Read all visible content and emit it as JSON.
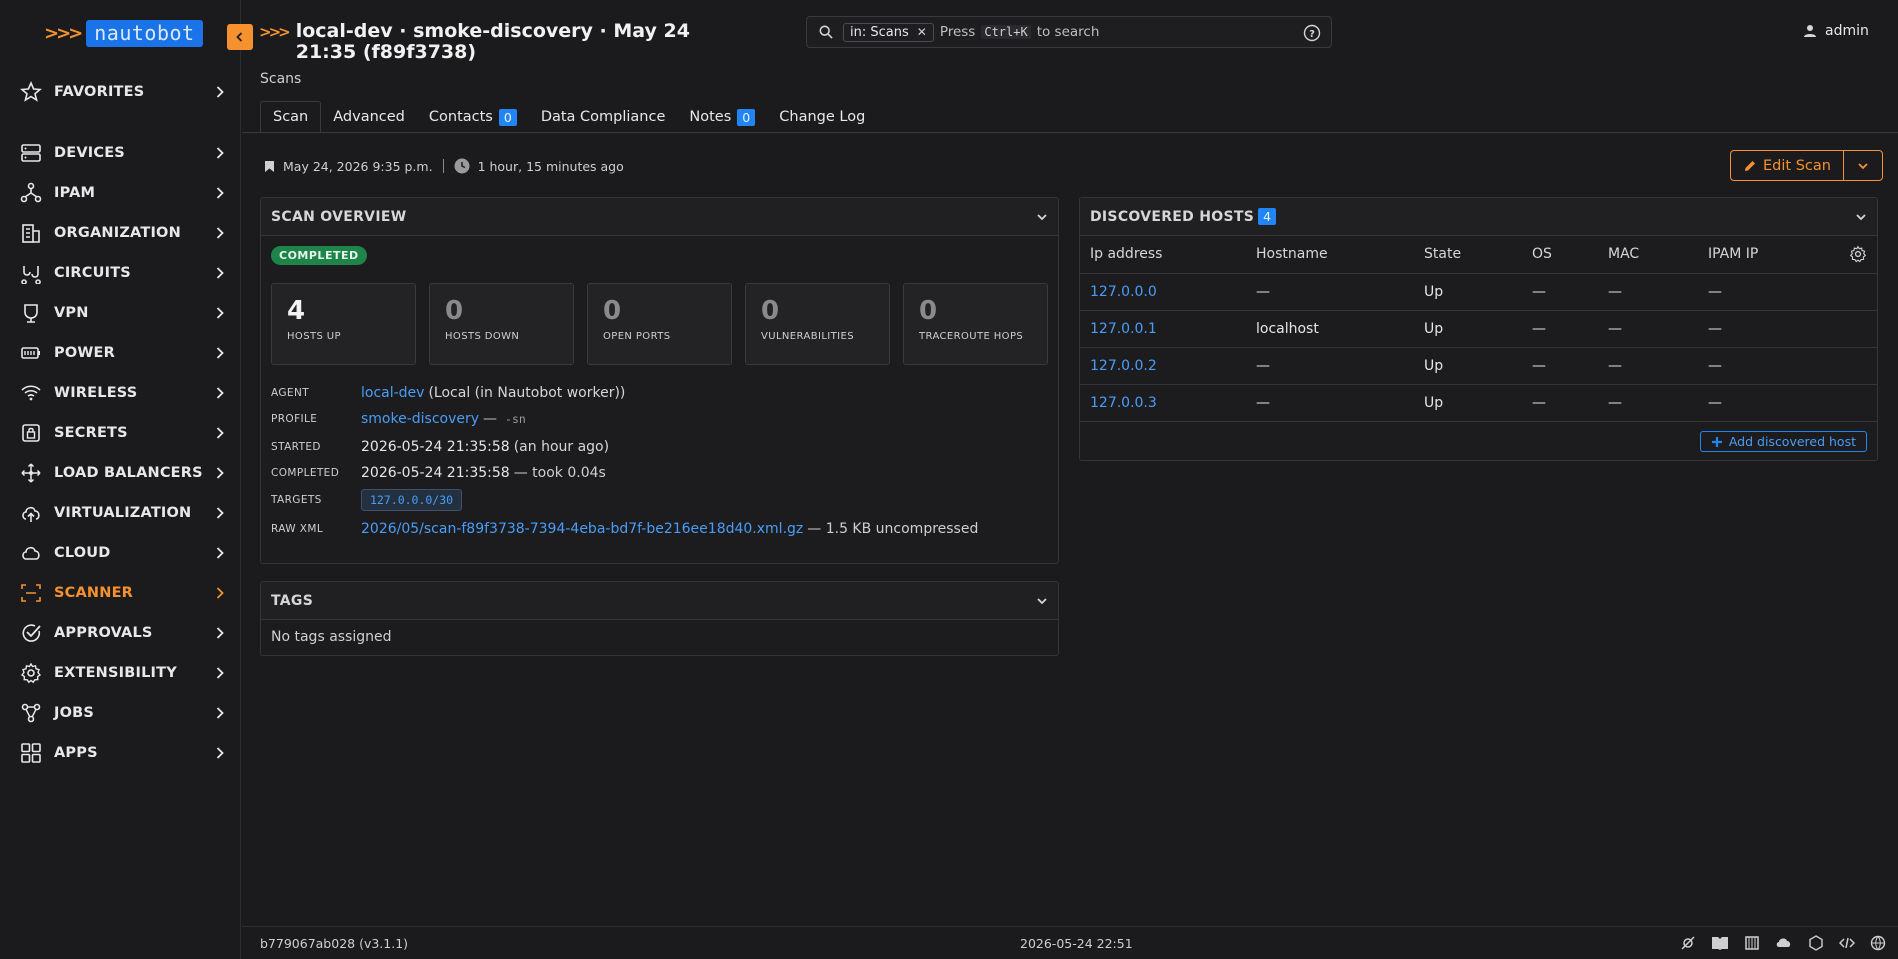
{
  "brand": {
    "chevrons": ">>>",
    "name": "nautobot",
    "accent": "#f5922f",
    "link": "#4a9df7"
  },
  "sidebar": {
    "items": [
      {
        "label": "FAVORITES",
        "icon": "star-icon"
      },
      {
        "label": "DEVICES",
        "icon": "server-icon"
      },
      {
        "label": "IPAM",
        "icon": "network-icon"
      },
      {
        "label": "ORGANIZATION",
        "icon": "building-icon"
      },
      {
        "label": "CIRCUITS",
        "icon": "circuit-icon"
      },
      {
        "label": "VPN",
        "icon": "shield-icon"
      },
      {
        "label": "POWER",
        "icon": "battery-icon"
      },
      {
        "label": "WIRELESS",
        "icon": "wifi-icon"
      },
      {
        "label": "SECRETS",
        "icon": "lock-icon"
      },
      {
        "label": "LOAD BALANCERS",
        "icon": "balancer-icon"
      },
      {
        "label": "VIRTUALIZATION",
        "icon": "cloud-upload-icon"
      },
      {
        "label": "CLOUD",
        "icon": "cloud-icon"
      },
      {
        "label": "SCANNER",
        "icon": "scan-icon",
        "active": true
      },
      {
        "label": "APPROVALS",
        "icon": "check-circle-icon"
      },
      {
        "label": "EXTENSIBILITY",
        "icon": "gear-icon"
      },
      {
        "label": "JOBS",
        "icon": "jobs-icon"
      },
      {
        "label": "APPS",
        "icon": "grid-icon"
      }
    ]
  },
  "header": {
    "chevrons": ">>>",
    "title": "local-dev · smoke-discovery · May 24 21:35 (f89f3738)",
    "breadcrumb": "Scans"
  },
  "search": {
    "scope_chip": "in: Scans",
    "press": "Press",
    "shortcut": "Ctrl+K",
    "suffix": "to search"
  },
  "user": {
    "name": "admin"
  },
  "tabs": [
    {
      "label": "Scan",
      "active": true
    },
    {
      "label": "Advanced"
    },
    {
      "label": "Contacts",
      "badge": "0"
    },
    {
      "label": "Data Compliance"
    },
    {
      "label": "Notes",
      "badge": "0"
    },
    {
      "label": "Change Log"
    }
  ],
  "meta": {
    "created": "May 24, 2026 9:35 p.m.",
    "updated": "1 hour, 15 minutes ago"
  },
  "actions": {
    "edit": "Edit Scan"
  },
  "overview": {
    "title": "SCAN OVERVIEW",
    "status": "COMPLETED",
    "status_color": "#1e8449",
    "stats": [
      {
        "value": "4",
        "label": "HOSTS UP"
      },
      {
        "value": "0",
        "label": "HOSTS DOWN"
      },
      {
        "value": "0",
        "label": "OPEN PORTS"
      },
      {
        "value": "0",
        "label": "VULNERABILITIES"
      },
      {
        "value": "0",
        "label": "TRACEROUTE HOPS"
      }
    ],
    "agent": {
      "key": "AGENT",
      "link": "local-dev",
      "rest": "(Local (in Nautobot worker))"
    },
    "profile": {
      "key": "PROFILE",
      "link": "smoke-discovery",
      "dash": "—",
      "args": "-sn"
    },
    "started": {
      "key": "STARTED",
      "value": "2026-05-24 21:35:58",
      "rel": "(an hour ago)"
    },
    "completed": {
      "key": "COMPLETED",
      "value": "2026-05-24 21:35:58",
      "rest": "— took 0.04s"
    },
    "targets": {
      "key": "TARGETS",
      "value": "127.0.0.0/30"
    },
    "raw_xml": {
      "key": "RAW XML",
      "link": "2026/05/scan-f89f3738-7394-4eba-bd7f-be216ee18d40.xml.gz",
      "rest": "— 1.5 KB uncompressed"
    }
  },
  "tags": {
    "title": "TAGS",
    "empty": "No tags assigned"
  },
  "hosts": {
    "title": "DISCOVERED HOSTS",
    "count": "4",
    "columns": [
      "Ip address",
      "Hostname",
      "State",
      "OS",
      "MAC",
      "IPAM IP"
    ],
    "rows": [
      [
        "127.0.0.0",
        "—",
        "Up",
        "—",
        "—",
        "—"
      ],
      [
        "127.0.0.1",
        "localhost",
        "Up",
        "—",
        "—",
        "—"
      ],
      [
        "127.0.0.2",
        "—",
        "Up",
        "—",
        "—",
        "—"
      ],
      [
        "127.0.0.3",
        "—",
        "Up",
        "—",
        "—",
        "—"
      ]
    ],
    "add": "Add discovered host"
  },
  "footer": {
    "version": "b779067ab028 (v3.1.1)",
    "timestamp": "2026-05-24 22:51"
  }
}
